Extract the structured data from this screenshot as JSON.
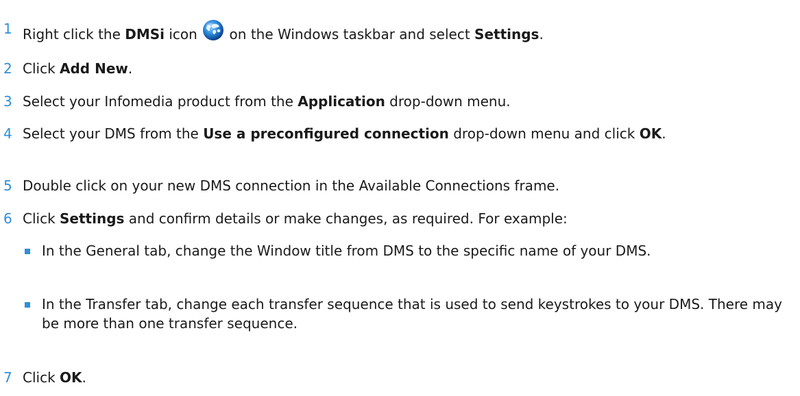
{
  "steps": [
    {
      "number": "1",
      "part1": "Right click the ",
      "bold1": "DMSi",
      "part2": " icon ",
      "icon": "dmsi-globe-icon",
      "part3": " on the Windows taskbar and select ",
      "bold2": "Settings",
      "part4": "."
    },
    {
      "number": "2",
      "part1": "Click ",
      "bold1": "Add New",
      "part2": "."
    },
    {
      "number": "3",
      "part1": "Select your Infomedia product from the ",
      "bold1": "Application",
      "part2": " drop-down menu."
    },
    {
      "number": "4",
      "part1": "Select your DMS from the ",
      "bold1": "Use a preconfigured connection",
      "part2": " drop-down menu and click ",
      "bold2": "OK",
      "part3": "."
    },
    {
      "number": "5",
      "part1": "Double click on your new DMS connection in the Available Connections frame."
    },
    {
      "number": "6",
      "part1": "Click ",
      "bold1": "Settings",
      "part2": " and confirm details or make changes, as required. For example:",
      "bullets": [
        "In the General tab, change the Window title from DMS to the specific name of your DMS.",
        "In the Transfer tab, change each transfer sequence that is used to send keystrokes to your DMS. There may be more than one transfer sequence."
      ]
    },
    {
      "number": "7",
      "part1": "Click ",
      "bold1": "OK",
      "part2": "."
    }
  ],
  "colors": {
    "accent": "#2f8fd8",
    "text": "#1a1a1a"
  }
}
